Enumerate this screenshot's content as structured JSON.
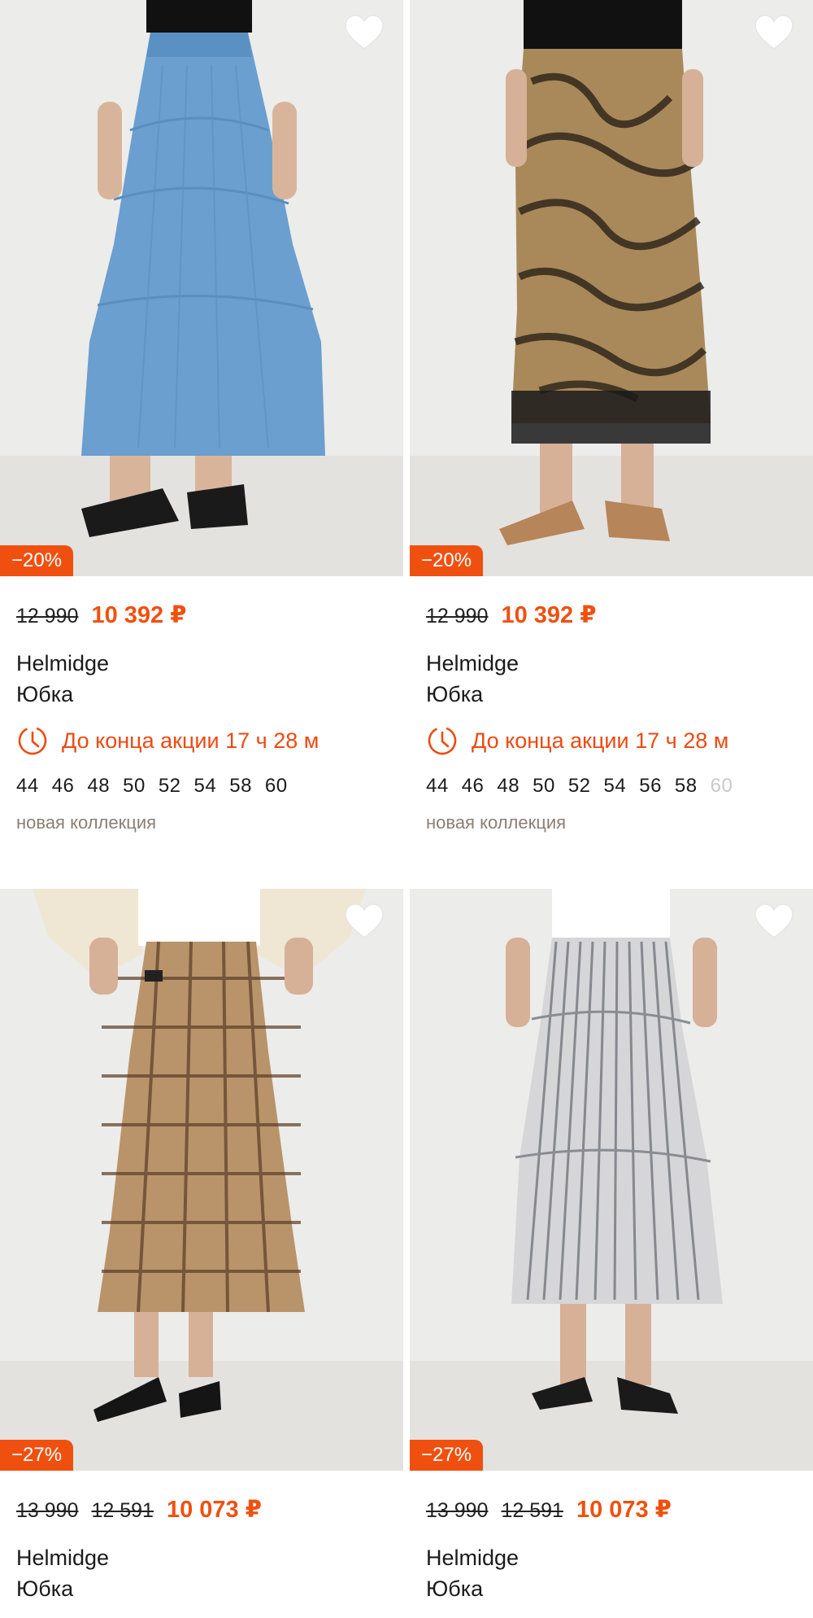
{
  "cards": [
    {
      "discount": "−20%",
      "old_price": "12 990",
      "price": "10 392 ₽",
      "brand": "Helmidge",
      "name": "Юбка",
      "promo": "До конца акции 17 ч 28 м",
      "sizes": [
        "44",
        "46",
        "48",
        "50",
        "52",
        "54",
        "58",
        "60"
      ],
      "tag": "новая коллекция",
      "image": "blue denim tiered maxi skirt",
      "color": "#6a9fcf"
    },
    {
      "discount": "−20%",
      "old_price": "12 990",
      "price": "10 392 ₽",
      "brand": "Helmidge",
      "name": "Юбка",
      "promo": "До конца акции 17 ч 28 м",
      "sizes": [
        "44",
        "46",
        "48",
        "50",
        "52",
        "54",
        "56",
        "58",
        "60"
      ],
      "tag": "новая коллекция",
      "image": "abstract printed midi skirt",
      "color": "#a9895a"
    },
    {
      "discount": "−27%",
      "old_price": "13 990",
      "mid_price": "12 591",
      "price": "10 073 ₽",
      "brand": "Helmidge",
      "name": "Юбка",
      "image": "beige check pleated skirt",
      "color": "#b9936a"
    },
    {
      "discount": "−27%",
      "old_price": "13 990",
      "mid_price": "12 591",
      "price": "10 073 ₽",
      "brand": "Helmidge",
      "name": "Юбка",
      "image": "white striped tiered skirt",
      "color": "#d6d6d8"
    }
  ],
  "icons": {
    "favorite": "heart-icon",
    "timer": "clock-icon"
  },
  "colors": {
    "accent": "#f0500f"
  }
}
